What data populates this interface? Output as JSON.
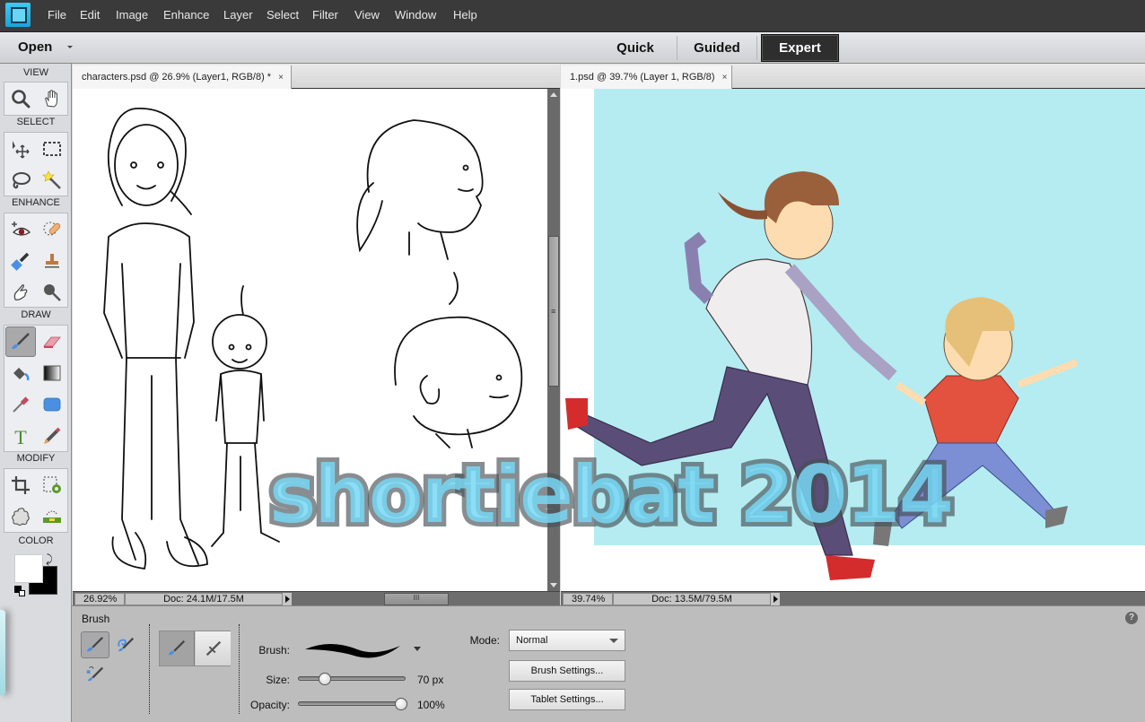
{
  "menubar": {
    "app_icon": "photoshop-elements-icon",
    "items": [
      "File",
      "Edit",
      "Image",
      "Enhance",
      "Layer",
      "Select",
      "Filter",
      "View",
      "Window",
      "Help"
    ]
  },
  "modebar": {
    "open_label": "Open",
    "modes": [
      {
        "label": "Quick",
        "active": false
      },
      {
        "label": "Guided",
        "active": false
      },
      {
        "label": "Expert",
        "active": true
      }
    ]
  },
  "toolbox": {
    "sections": [
      {
        "label": "VIEW",
        "tools": [
          "zoom-tool",
          "hand-tool"
        ]
      },
      {
        "label": "SELECT",
        "tools": [
          "move-tool",
          "rectangular-marquee-tool",
          "lasso-tool",
          "magic-wand-tool"
        ]
      },
      {
        "label": "ENHANCE",
        "tools": [
          "red-eye-removal-tool",
          "spot-healing-brush-tool",
          "smart-brush-tool",
          "clone-stamp-tool",
          "smudge-tool",
          "sponge-tool"
        ]
      },
      {
        "label": "DRAW",
        "tools": [
          "brush-tool",
          "eraser-tool",
          "paint-bucket-tool",
          "gradient-tool",
          "eyedropper-tool",
          "shape-tool",
          "type-tool",
          "pencil-tool"
        ]
      },
      {
        "label": "MODIFY",
        "tools": [
          "crop-tool",
          "recompose-tool",
          "content-aware-move-tool",
          "straighten-tool"
        ]
      },
      {
        "label": "COLOR"
      }
    ],
    "active_tool": "brush-tool",
    "foreground_color": "#ffffff",
    "background_color": "#000000"
  },
  "documents": [
    {
      "tab_title": "characters.psd @ 26.9% (Layer1, RGB/8) *",
      "close": "×",
      "zoom": "26.92%",
      "doc_size": "Doc: 24.1M/17.5M",
      "vscroll_grip": "≡",
      "hscroll_grip": "III"
    },
    {
      "tab_title": "1.psd @ 39.7% (Layer 1, RGB/8)",
      "close": "×",
      "zoom": "39.74%",
      "doc_size": "Doc: 13.5M/79.5M"
    }
  ],
  "canvas": {
    "watermark": "shortiebat 2014",
    "sky_color": "#b4ecf1"
  },
  "options": {
    "title": "Brush",
    "brush_label": "Brush:",
    "size_label": "Size:",
    "size_value": "70 px",
    "size_fraction": 0.25,
    "opacity_label": "Opacity:",
    "opacity_value": "100%",
    "opacity_fraction": 1.0,
    "mode_label": "Mode:",
    "mode_value": "Normal",
    "brush_settings": "Brush Settings...",
    "tablet_settings": "Tablet Settings...",
    "help": "?"
  }
}
